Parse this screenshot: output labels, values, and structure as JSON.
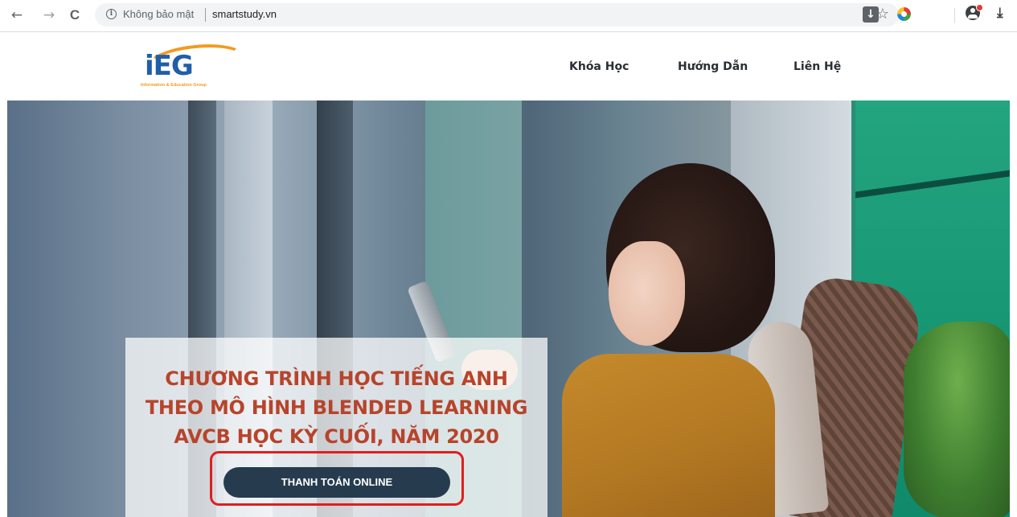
{
  "browser": {
    "security_text": "Không bảo mật",
    "url": "smartstudy.vn",
    "back_glyph": "←",
    "forward_glyph": "→",
    "reload_glyph": "C",
    "star_glyph": "☆",
    "download_ext_glyph": "↓",
    "menu_download_glyph": "⤓"
  },
  "header": {
    "logo_text": "iEG",
    "logo_subtitle": "Information & Education Group",
    "nav": [
      {
        "label": "Khóa Học"
      },
      {
        "label": "Hướng Dẫn"
      },
      {
        "label": "Liên Hệ"
      }
    ]
  },
  "hero": {
    "title_lines": [
      "CHƯƠNG TRÌNH HỌC TIẾNG ANH",
      "THEO MÔ HÌNH BLENDED LEARNING",
      "AVCB HỌC KỲ CUỐI, NĂM 2020"
    ],
    "cta_label": "THANH TOÁN ONLINE"
  },
  "colors": {
    "brand_blue": "#1f5fa8",
    "brand_orange": "#f39a1e",
    "title_red": "#b7442b",
    "cta_bg": "#263c4e",
    "highlight_red": "#e01e1e"
  }
}
